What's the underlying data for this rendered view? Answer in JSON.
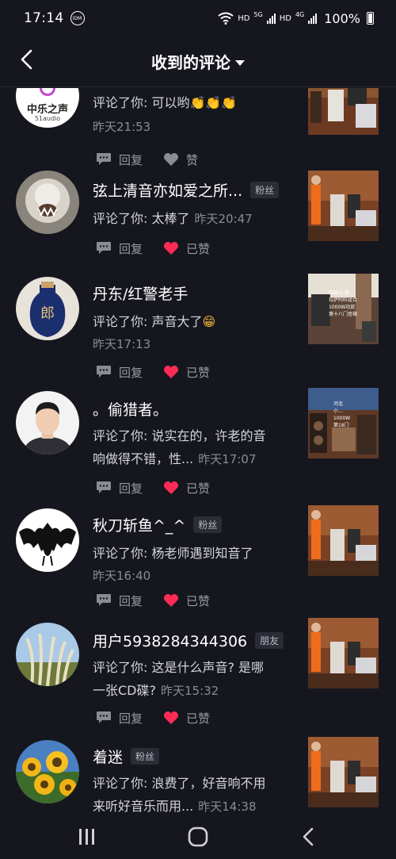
{
  "status": {
    "time": "17:14",
    "idm": "IDM",
    "hd1": "HD",
    "net1": "5G",
    "hd2": "HD",
    "net2": "4G",
    "battery": "100%"
  },
  "header": {
    "title": "收到的评论"
  },
  "actions": {
    "reply": "回复",
    "like": "赞",
    "liked": "已赞"
  },
  "first_avatar_text": {
    "line1": "中乐之声",
    "line2": "51audio"
  },
  "thumb_captions": {
    "c1": "四朗山 摘\n拉萨阿旺组合\n1000W功放\n第十八门音箱",
    "c2": "河北\n小…\n1000W\n第18门"
  },
  "comments": [
    {
      "name": "",
      "tag": "",
      "text": "评论了你: 可以哟",
      "emoji": "👏👏👏",
      "time": "昨天21:53",
      "liked": false
    },
    {
      "name": "弦上清音亦如爱之所...",
      "tag": "粉丝",
      "text": "评论了你: 太棒了",
      "time": "昨天20:47",
      "liked": true
    },
    {
      "name": "丹东/红警老手",
      "tag": "",
      "text": "评论了你: 声音大了",
      "emoji": "😁",
      "time": "昨天17:13",
      "liked": true
    },
    {
      "name": "。偷猎者。",
      "tag": "",
      "text_line1": "评论了你: 说实在的，许老的音",
      "text_line2": "响做得不错，性...",
      "time": "昨天17:07",
      "liked": true
    },
    {
      "name": "秋刀斩鱼^_^",
      "tag": "粉丝",
      "text": "评论了你: 杨老师遇到知音了",
      "time": "昨天16:40",
      "liked": true
    },
    {
      "name": "用户5938284344306",
      "tag": "朋友",
      "text_line1": "评论了你: 这是什么声音? 是哪",
      "text_line2": "一张CD碟?",
      "time": "昨天15:32",
      "liked": true
    },
    {
      "name": "着迷",
      "tag": "粉丝",
      "text_line1": "评论了你: 浪费了，好音响不用",
      "text_line2": "来听好音乐而用...",
      "time": "昨天14:38",
      "liked": false
    }
  ],
  "colors": {
    "background": "#16161f",
    "heart_red": "#fe2c55",
    "muted": "#8b8b93",
    "tag_bg": "#2c2c36"
  }
}
